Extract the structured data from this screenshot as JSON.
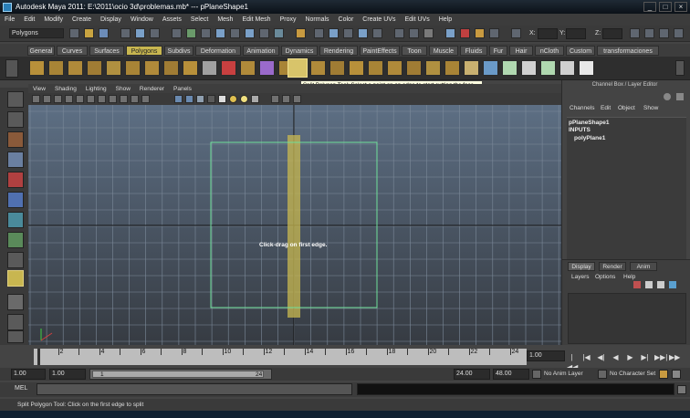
{
  "window": {
    "title": "Autodesk Maya 2011: E:\\2011\\ocio 3d\\problemas.mb*  ---  pPlaneShape1",
    "buttons": [
      "_",
      "□",
      "×"
    ]
  },
  "menubar": [
    "File",
    "Edit",
    "Modify",
    "Create",
    "Display",
    "Window",
    "Assets",
    "Select",
    "Mesh",
    "Edit Mesh",
    "Proxy",
    "Normals",
    "Color",
    "Create UVs",
    "Edit UVs",
    "Help"
  ],
  "statusline": {
    "mode": "Polygons",
    "xyz": [
      "X:",
      "Y:",
      "Z:"
    ]
  },
  "shelf": {
    "tabs": [
      "General",
      "Curves",
      "Surfaces",
      "Polygons",
      "Subdivs",
      "Deformation",
      "Animation",
      "Dynamics",
      "Rendering",
      "PaintEffects",
      "Toon",
      "Muscle",
      "Fluids",
      "Fur",
      "Hair",
      "nCloth",
      "Custom",
      "transformaciones"
    ],
    "active_tab": "Polygons"
  },
  "tooltip": "Split Polygon Tool: Select a point on an edge to start cutting the face",
  "panel": {
    "menus": [
      "View",
      "Shading",
      "Lighting",
      "Show",
      "Renderer",
      "Panels"
    ],
    "hint": "Click-drag on first edge."
  },
  "channelbox": {
    "title": "Channel Box / Layer Editor",
    "menus": [
      "Channels",
      "Edit",
      "Object",
      "Show"
    ],
    "object": "pPlaneShape1",
    "inputs_label": "INPUTS",
    "input_node": "polyPlane1"
  },
  "layereditor": {
    "tabs": [
      "Display",
      "Render",
      "Anim"
    ],
    "menus": [
      "Layers",
      "Options",
      "Help"
    ]
  },
  "timeslider": {
    "ticks": [
      "2",
      "4",
      "6",
      "8",
      "10",
      "12",
      "14",
      "16",
      "18",
      "20",
      "22",
      "24"
    ],
    "current_frame": "1.00",
    "playback_buttons": [
      "|◀◀",
      "|◀",
      "◀|",
      "◀",
      "▶",
      "▶|",
      "▶▶|",
      "▶▶"
    ]
  },
  "rangebar": {
    "start": "1.00",
    "playback_start": "1.00",
    "range_left": "1",
    "range_right": "24",
    "playback_end": "24.00",
    "end": "48.00",
    "anim_layer": "No Anim Layer",
    "character_set": "No Character Set"
  },
  "cmdline": {
    "label": "MEL"
  },
  "helpline": "Split Polygon Tool: Click on the first edge to split",
  "colors": {
    "accent_tab": "#c8b650",
    "viewport_top": "#5d6f84",
    "viewport_bottom": "#363b42",
    "selection_green": "#6fe09a"
  }
}
